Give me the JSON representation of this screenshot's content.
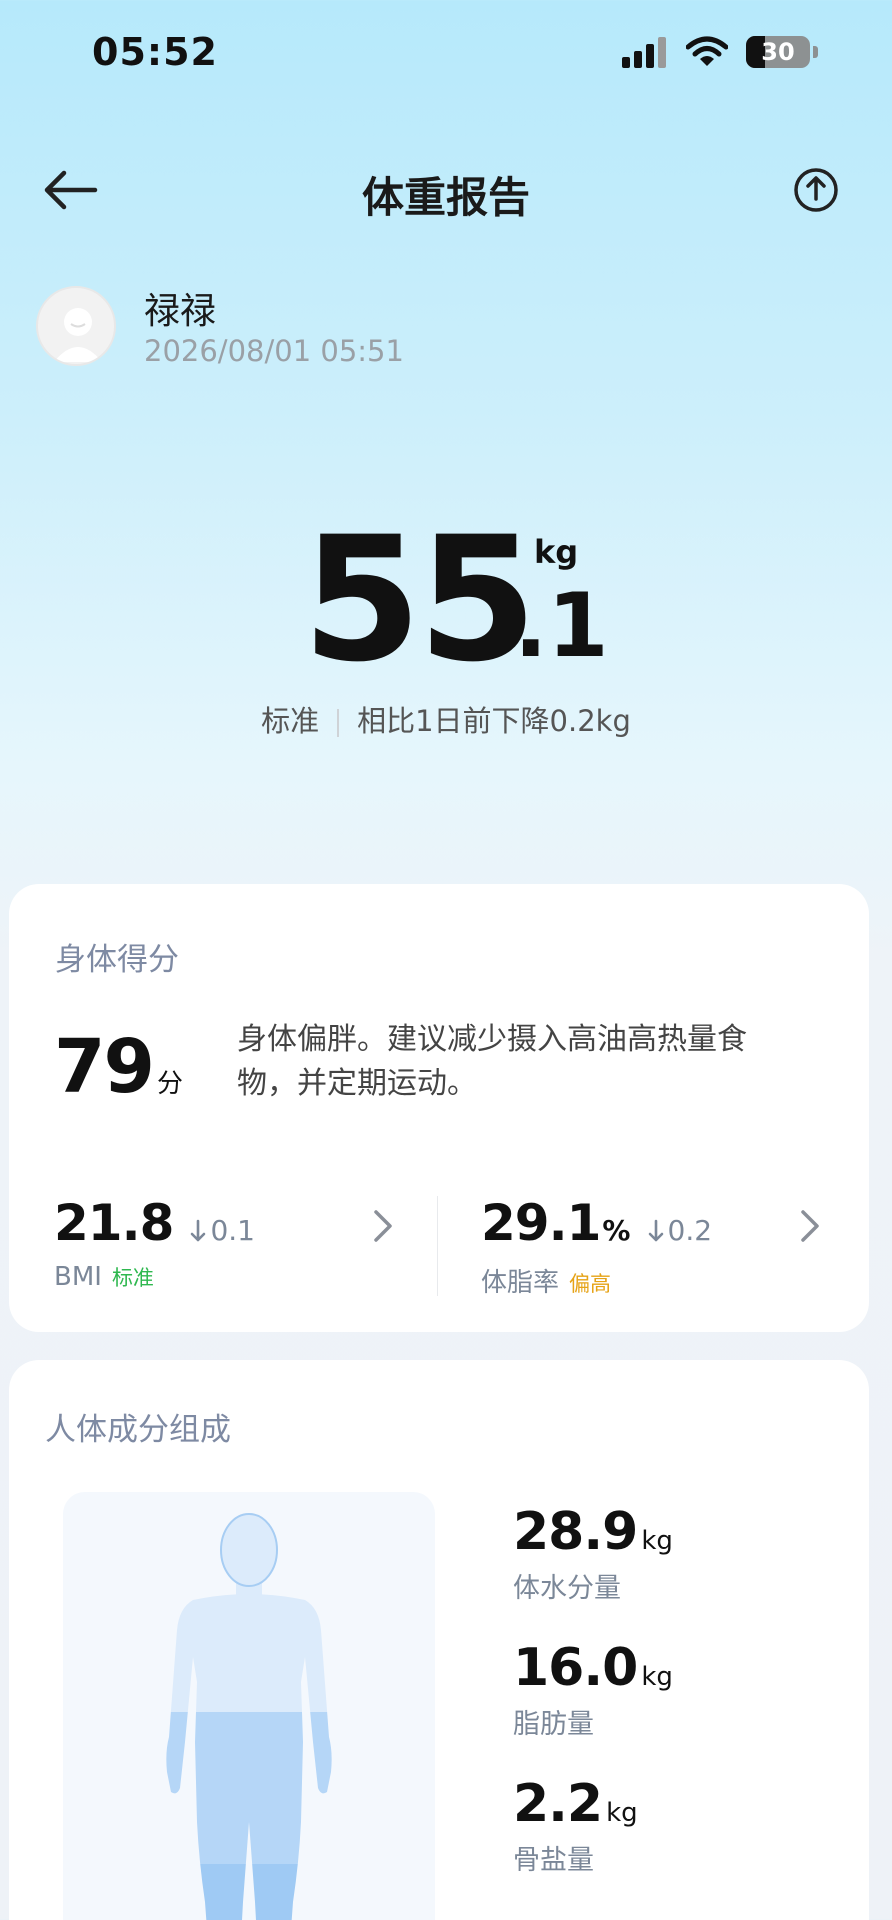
{
  "status_bar": {
    "time": "05:52",
    "battery": "30",
    "battery_percent": 30
  },
  "header": {
    "title": "体重报告"
  },
  "user": {
    "name": "禄禄",
    "timestamp": "2026/08/01 05:51"
  },
  "weight": {
    "integer": "55",
    "decimal": ".1",
    "unit": "kg",
    "status": "标准",
    "change": "相比1日前下降0.2kg"
  },
  "body_score": {
    "title": "身体得分",
    "score": "79",
    "unit": "分",
    "description": "身体偏胖。建议减少摄入高油高热量食物，并定期运动。",
    "bmi": {
      "value": "21.8",
      "delta": "0.1",
      "label": "BMI",
      "badge": "标准",
      "badge_color": "#2fb84f"
    },
    "body_fat": {
      "value": "29.1",
      "unit": "%",
      "delta": "0.2",
      "label": "体脂率",
      "badge": "偏高",
      "badge_color": "#e6a317"
    }
  },
  "composition": {
    "title": "人体成分组成",
    "items": [
      {
        "value": "28.9",
        "unit": "kg",
        "label": "体水分量"
      },
      {
        "value": "16.0",
        "unit": "kg",
        "label": "脂肪量"
      },
      {
        "value": "2.2",
        "unit": "kg",
        "label": "骨盐量"
      }
    ]
  },
  "icons": {
    "signal": "signal-icon",
    "wifi": "wifi-icon",
    "battery": "battery-icon",
    "back": "back-arrow-icon",
    "share": "share-icon",
    "avatar": "default-avatar-icon",
    "down_arrow": "arrow-down-icon",
    "chevron": "chevron-right-icon"
  },
  "colors": {
    "accent_green": "#2fb84f",
    "accent_orange": "#e6a317",
    "header_gradient_top": "#b6e9fb",
    "body_figure_light": "#dcebfb",
    "body_figure_mid": "#b5d6f7",
    "body_figure_dark": "#9fcaf4"
  }
}
